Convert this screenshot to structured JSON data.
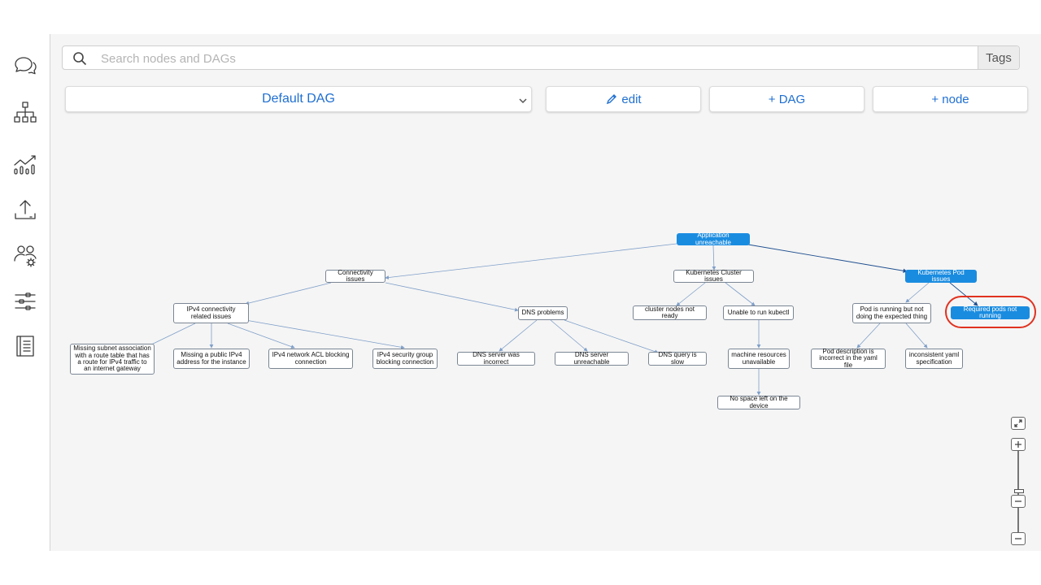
{
  "sidebar": {
    "items": [
      {
        "name": "chat",
        "icon": "chat-bubbles-icon"
      },
      {
        "name": "hierarchy",
        "icon": "hierarchy-icon"
      },
      {
        "name": "analytics",
        "icon": "analytics-chart-icon"
      },
      {
        "name": "upload",
        "icon": "upload-icon"
      },
      {
        "name": "users-settings",
        "icon": "users-gear-icon"
      },
      {
        "name": "filters",
        "icon": "sliders-icon"
      },
      {
        "name": "docs",
        "icon": "book-icon"
      }
    ]
  },
  "search": {
    "placeholder": "Search nodes and DAGs",
    "value": "",
    "tags_label": "Tags"
  },
  "toolbar": {
    "dag_selected": "Default DAG",
    "edit_label": "edit",
    "add_dag_label": "+ DAG",
    "add_node_label": "+ node"
  },
  "graph": {
    "nodes": {
      "root": "Application unreachable",
      "connectivity": "Connectivity issues",
      "k8s_cluster": "Kubernetes Cluster issues",
      "k8s_pod": "Kubernetes Pod issues",
      "ipv4": "IPv4 connectivity related issues",
      "dns": "DNS problems",
      "cluster_nodes": "cluster nodes not ready",
      "kubectl": "Unable to run kubectl",
      "pod_running": "Pod is running but not doing the expected thing",
      "required_pods": "Required pods not running",
      "missing_subnet": "Missing subnet association with a route table that has a route for IPv4 traffic to an internet gateway",
      "missing_ipv4": "Missing a public IPv4 address for the instance",
      "acl": "IPv4 network ACL blocking connection",
      "sg": "IPv4 security group blocking connection",
      "dns_incorrect": "DNS server was incorrect",
      "dns_unreachable": "DNS server unreachable",
      "dns_slow": "DNS query is slow",
      "machine_resources": "machine resources unavailable",
      "pod_description": "Pod description is incorrect in the yaml file",
      "yaml_spec": "inconsistent yaml specification",
      "no_space": "No space left on the device"
    },
    "selected": "required_pods",
    "colors": {
      "accent": "#1a8ce0",
      "highlight": "#e0321f",
      "edge": "#7f9fc9",
      "edge_dark": "#1f4f8f"
    }
  },
  "zoom_controls": {
    "fit_icon": "fit-screen-icon",
    "in_icon": "zoom-in-icon",
    "out_icon": "zoom-out-icon",
    "level": 0.55
  }
}
